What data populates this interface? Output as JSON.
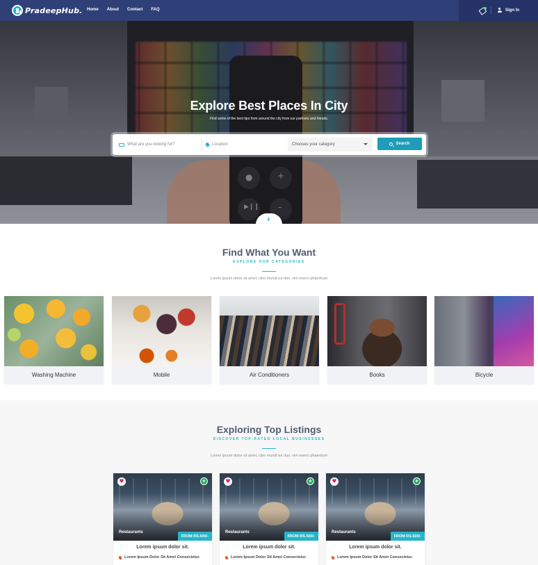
{
  "nav": {
    "brand": "PradeepHub.",
    "links": [
      "Home",
      "About",
      "Contact",
      "FAQ"
    ],
    "signin_label": "Sign In"
  },
  "hero": {
    "title": "Explore Best Places In City",
    "subtitle": "Find some of the best tips from around the city from our partners and friends.",
    "search": {
      "what_placeholder": "What are you looking for?",
      "location_placeholder": "Location",
      "category_selected": "Chooses your category",
      "button_label": "Search"
    }
  },
  "categories_section": {
    "title": "Find What You Want",
    "kicker": "EXPLORE OUR CATEGORIES",
    "description": "Lorem ipsum dolor sit amet, cibo mundi ea duo, vim exerci phaedrum",
    "items": [
      {
        "label": "Washing Machine"
      },
      {
        "label": "Mobile"
      },
      {
        "label": "Air Conditioners"
      },
      {
        "label": "Books"
      },
      {
        "label": "Bicycle"
      }
    ]
  },
  "listings_section": {
    "title": "Exploring Top Listings",
    "kicker": "DISCOVER TOP-RATED LOCAL BUSINESSES",
    "description": "Lorem ipsum dolor sit amet, cibo mundi ea duo, vim exerci phaedrum",
    "items": [
      {
        "category": "Restaurants",
        "price": "FROM RS.500/-",
        "title": "Lorem ipsum dolor sit.",
        "address": "Lorem Ipsum Dolor Sit Amet Consectetur."
      },
      {
        "category": "Restaurants",
        "price": "FROM RS.500/-",
        "title": "Lorem ipsum dolor sit.",
        "address": "Lorem Ipsum Dolor Sit Amet Consectetur."
      },
      {
        "category": "Restaurants",
        "price": "FROM RS.500/-",
        "title": "Lorem ipsum dolor sit.",
        "address": "Lorem Ipsum Dolor Sit Amet Consectetur."
      }
    ]
  },
  "icons": {
    "search": "search-icon",
    "keyboard": "keyboard-icon",
    "location": "location-pin-icon",
    "heart": "heart-icon",
    "star": "star-badge-icon",
    "user": "user-icon",
    "tag": "tag-icon",
    "scroll": "chevron-double-down-icon"
  },
  "colors": {
    "navbar": "#2f3f78",
    "accent": "#27b4c8",
    "search_button": "#1f9cb8",
    "heart": "#e0245e",
    "verified": "#27ae60"
  }
}
